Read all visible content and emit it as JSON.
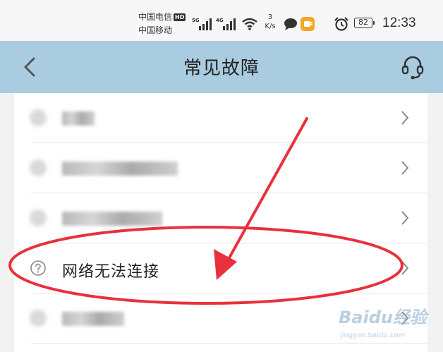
{
  "status_bar": {
    "carrier1": "中国电信",
    "carrier1_badge": "HD",
    "carrier2": "中国移动",
    "net_speed_value": "3",
    "net_speed_unit": "K/s",
    "battery": "82",
    "time": "12:33",
    "icons": [
      "5g-signal-icon",
      "4g-signal-icon",
      "wifi-icon",
      "message-icon",
      "app-notification-icon",
      "alarm-icon",
      "battery-icon"
    ]
  },
  "nav": {
    "title": "常见故障",
    "back_icon": "chevron-left-icon",
    "service_icon": "customer-service-headset-icon",
    "background": "#a9cce0"
  },
  "faults": [
    {
      "label": "网络无法连接",
      "icon": "question-circle-icon"
    }
  ],
  "watermark": {
    "brand": "Baidu经验",
    "url": "jingyan.baidu.com"
  },
  "annotation_color": "#e8313b"
}
